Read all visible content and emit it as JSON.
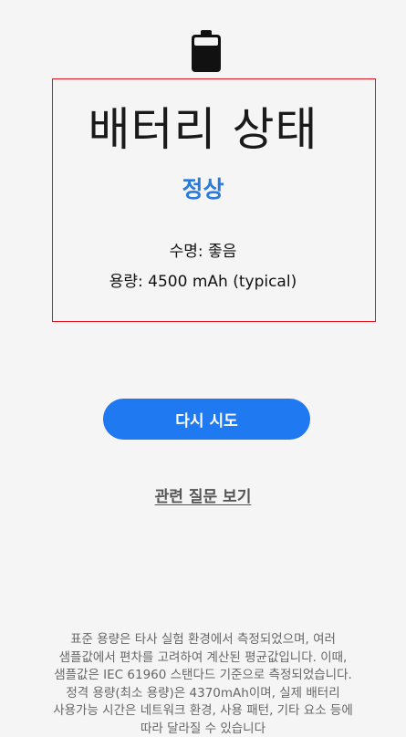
{
  "battery": {
    "title": "배터리 상태",
    "status": "정상",
    "life": "수명: 좋음",
    "capacity": "용량: 4500 mAh (typical)"
  },
  "actions": {
    "retry_label": "다시 시도",
    "faq_label": "관련 질문 보기"
  },
  "disclaimer_lines": [
    "표준 용량은 타사 실험 환경에서 측정되었으며, 여러",
    "샘플값에서 편차를 고려하여 계산된 평균값입니다. 이때,",
    "샘플값은 IEC 61960 스탠다드 기준으로 측정되었습니다.",
    "정격 용량(최소 용량)은 4370mAh이며, 실제 배터리",
    "사용가능 시간은 네트워크 환경, 사용 패턴, 기타 요소 등에",
    "따라 달라질 수 있습니다"
  ],
  "icons": {
    "battery": "battery-icon"
  },
  "colors": {
    "accent": "#1f7af2",
    "status_text": "#2a7bdc",
    "highlight_border": "#e0121e",
    "background": "#f5f5f5"
  }
}
